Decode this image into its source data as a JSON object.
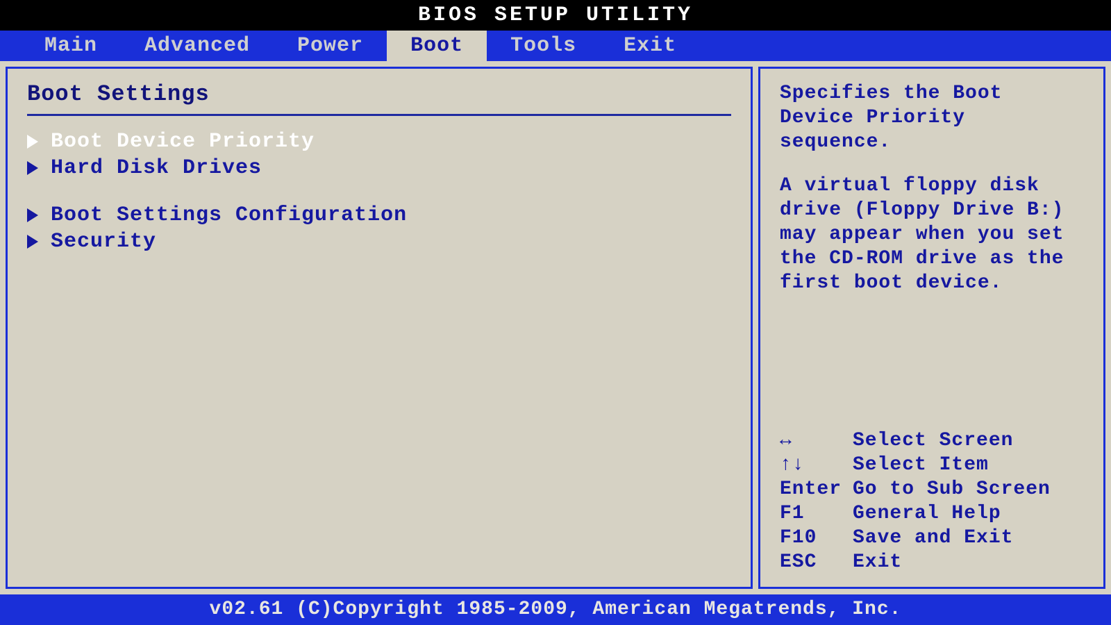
{
  "title": "BIOS SETUP UTILITY",
  "tabs": {
    "main": "Main",
    "advanced": "Advanced",
    "power": "Power",
    "boot": "Boot",
    "tools": "Tools",
    "exit": "Exit"
  },
  "section_title": "Boot Settings",
  "items": {
    "boot_device_priority": "Boot Device Priority",
    "hard_disk_drives": "Hard Disk Drives",
    "boot_settings_config": "Boot Settings Configuration",
    "security": "Security"
  },
  "help": {
    "p1": "Specifies the Boot Device Priority sequence.",
    "p2": "A virtual floppy disk drive (Floppy Drive B:) may appear when you set the CD-ROM drive as the first boot device."
  },
  "keys": {
    "lr": {
      "k": "↔",
      "d": "Select Screen"
    },
    "ud": {
      "k": "↑↓",
      "d": "Select Item"
    },
    "enter": {
      "k": "Enter",
      "d": "Go to Sub Screen"
    },
    "f1": {
      "k": "F1",
      "d": "General Help"
    },
    "f10": {
      "k": "F10",
      "d": "Save and Exit"
    },
    "esc": {
      "k": "ESC",
      "d": "Exit"
    }
  },
  "footer": "v02.61 (C)Copyright 1985-2009, American Megatrends, Inc."
}
